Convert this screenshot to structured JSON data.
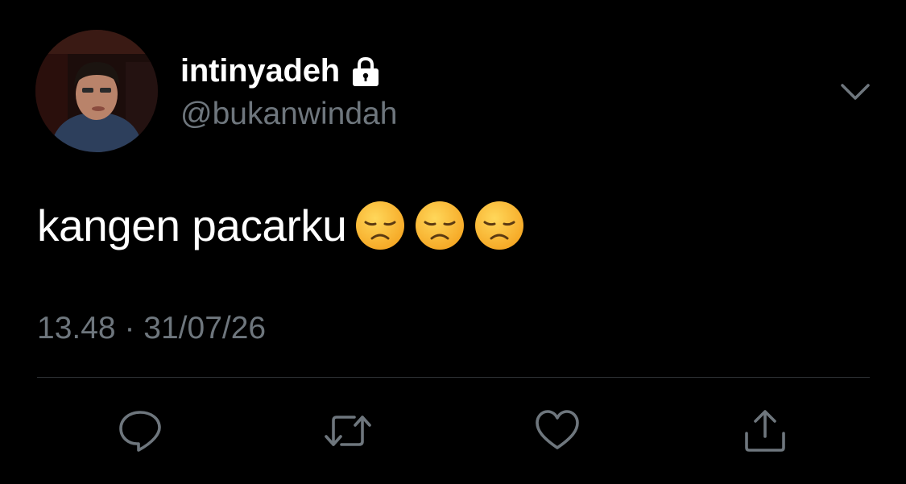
{
  "user": {
    "display_name": "intinyadeh",
    "handle": "@bukanwindah",
    "protected_icon": "lock-icon",
    "avatar": "avatar-photo"
  },
  "tweet": {
    "text": "kangen pacarku",
    "emojis": [
      "disappointed-face-emoji",
      "disappointed-face-emoji",
      "disappointed-face-emoji"
    ],
    "time": "13.48",
    "separator": "·",
    "date": "31/07/26"
  },
  "menu": {
    "icon": "chevron-down-icon"
  },
  "actions": [
    {
      "icon": "reply-icon"
    },
    {
      "icon": "retweet-icon"
    },
    {
      "icon": "like-heart-icon"
    },
    {
      "icon": "share-icon"
    }
  ],
  "colors": {
    "background": "#000000",
    "primary_text": "#ffffff",
    "secondary_text": "#6e767d",
    "divider": "#2f3336",
    "emoji_face": "#fbbf2d"
  }
}
